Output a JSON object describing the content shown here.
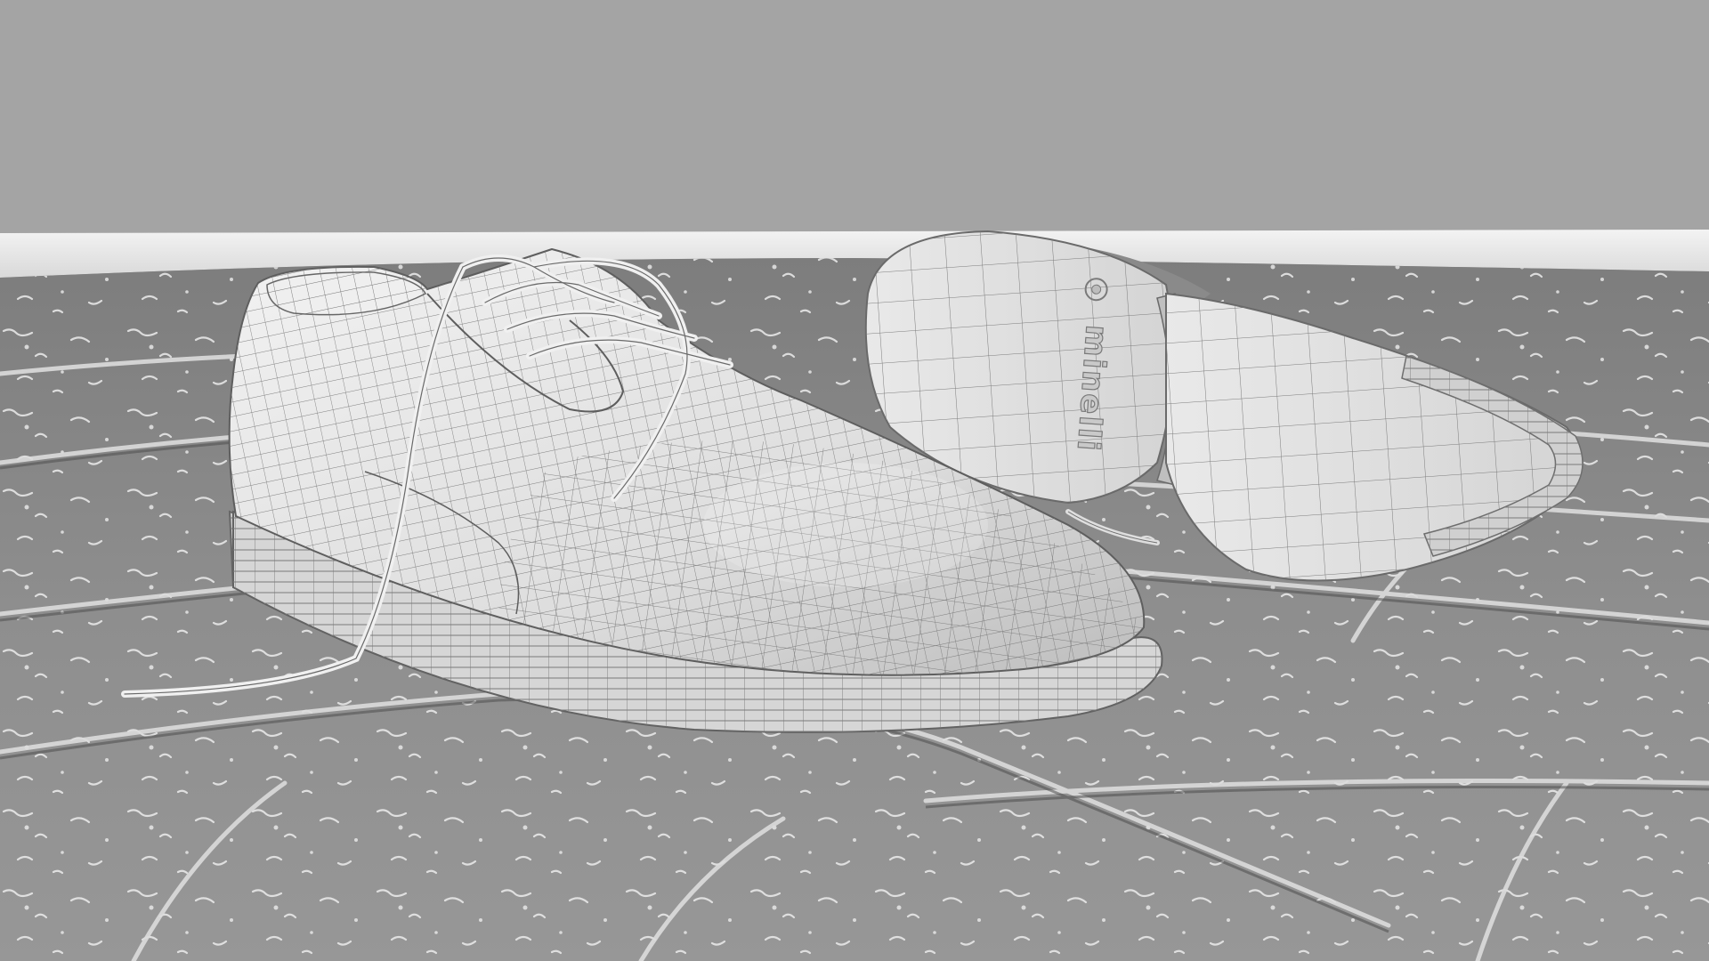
{
  "scene": {
    "kind": "3d-wireframe-render",
    "subject": "pair-of-derby-shoes",
    "colors": {
      "backdrop": "#a4a4a4",
      "baseboard": "#e3e3e3",
      "floor_light": "#cfcfcf",
      "floor_dark": "#5f5f5f",
      "shoe_surface": "#dcdcdc",
      "wire": "#6e6e6e"
    }
  },
  "sole_branding": {
    "text": "minelli"
  }
}
